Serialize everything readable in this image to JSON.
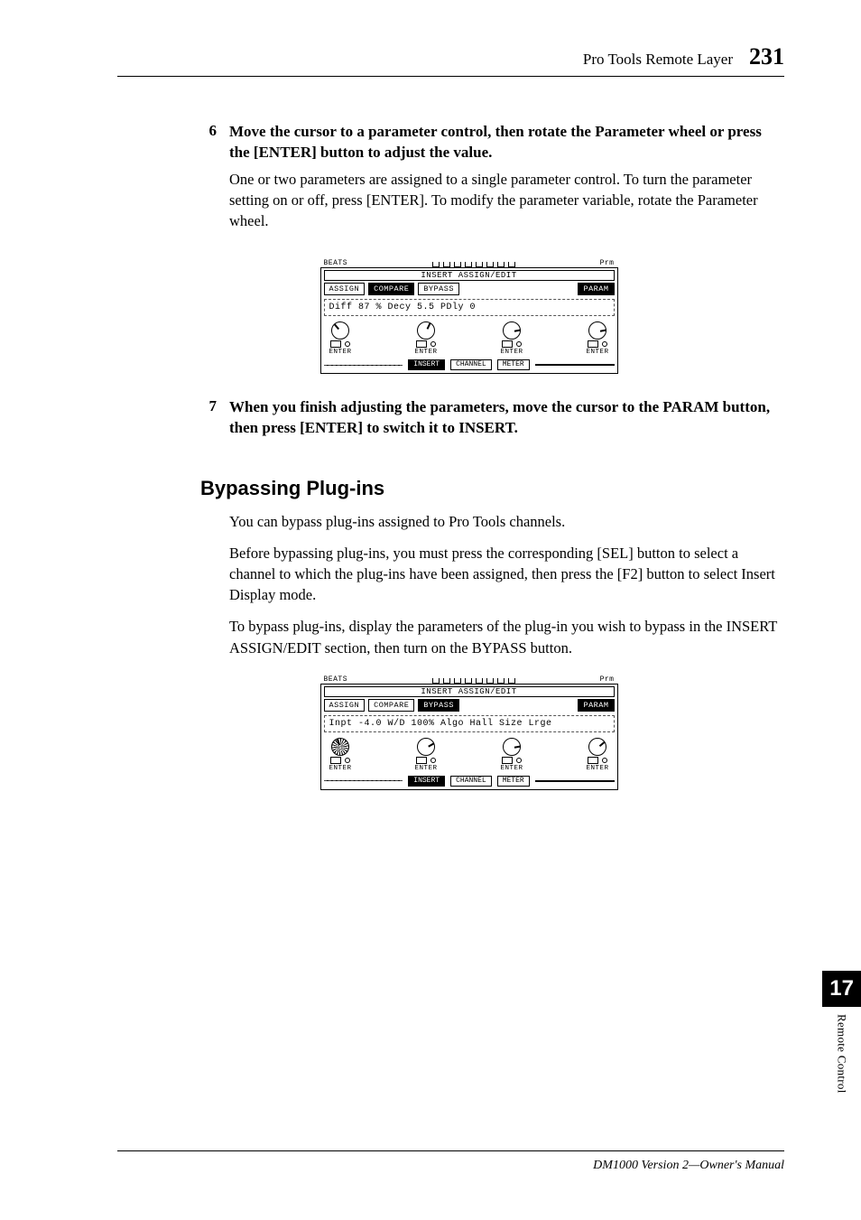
{
  "header": {
    "title": "Pro Tools Remote Layer",
    "page": "231"
  },
  "steps": {
    "s6": {
      "num": "6",
      "heading": "Move the cursor to a parameter control, then rotate the Parameter wheel or press the [ENTER] button to adjust the value.",
      "para": "One or two parameters are assigned to a single parameter control. To turn the parameter setting on or off, press [ENTER]. To modify the parameter variable, rotate the Parameter wheel."
    },
    "s7": {
      "num": "7",
      "heading": "When you finish adjusting the parameters, move the cursor to the PARAM button, then press [ENTER] to switch it to INSERT."
    }
  },
  "section": {
    "heading": "Bypassing Plug-ins",
    "p1": "You can bypass plug-ins assigned to Pro Tools channels.",
    "p2": "Before bypassing plug-ins, you must press the corresponding [SEL] button to select a channel to which the plug-ins have been assigned, then press the [F2] button to select Insert Display mode.",
    "p3": "To bypass plug-ins, display the parameters of the plug-in you wish to bypass in the INSERT ASSIGN/EDIT section, then turn on the BYPASS button."
  },
  "fig1": {
    "top_left": "BEATS",
    "top_right": "Prm",
    "title": "INSERT ASSIGN/EDIT",
    "btns": {
      "assign": "ASSIGN",
      "compare": "COMPARE",
      "bypass": "BYPASS",
      "param": "PARAM"
    },
    "params": "Diff 87 %  Decy 5.5  PDly 0",
    "enter": "ENTER",
    "tabs": {
      "insert": "INSERT",
      "channel": "CHANNEL",
      "meter": "METER"
    }
  },
  "fig2": {
    "top_left": "BEATS",
    "top_right": "Prm",
    "title": "INSERT ASSIGN/EDIT",
    "btns": {
      "assign": "ASSIGN",
      "compare": "COMPARE",
      "bypass": "BYPASS",
      "param": "PARAM"
    },
    "params": "Inpt -4.0 W/D  100% Algo Hall Size Lrge",
    "enter": "ENTER",
    "tabs": {
      "insert": "INSERT",
      "channel": "CHANNEL",
      "meter": "METER"
    }
  },
  "side": {
    "chapter": "17",
    "label": "Remote Control"
  },
  "footer": "DM1000 Version 2—Owner's Manual"
}
